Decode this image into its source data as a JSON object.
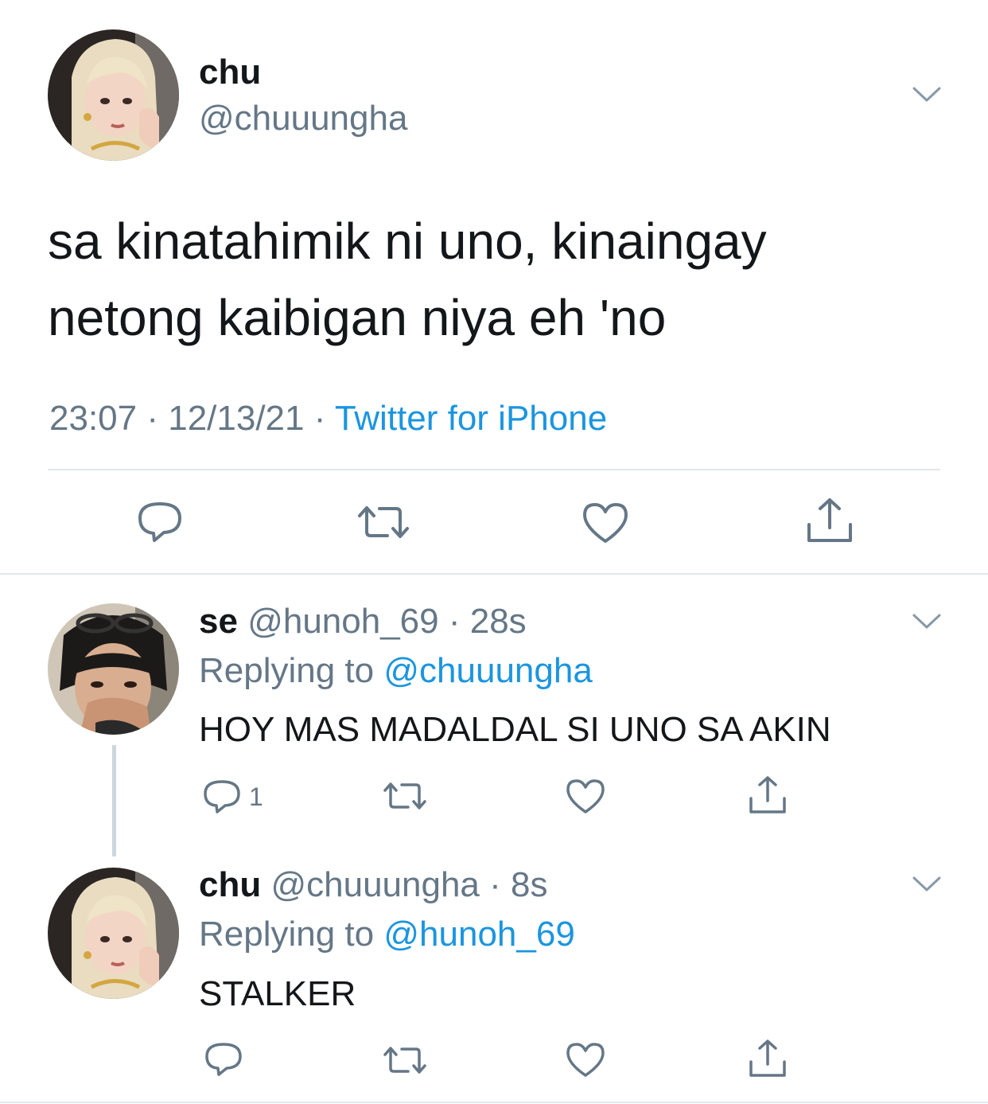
{
  "colors": {
    "text": "#14171a",
    "secondary": "#657786",
    "link": "#1b95e0",
    "divider": "#e1e8ed",
    "thread_line": "#ccd6dd"
  },
  "main_tweet": {
    "name": "chu",
    "handle": "@chuuungha",
    "text_line1": "sa kinatahimik ni uno, kinaingay",
    "text_line2": "netong kaibigan niya eh 'no",
    "time": "23:07",
    "sep1": " · ",
    "date": "12/13/21",
    "sep2": " · ",
    "source": "Twitter for iPhone",
    "menu_icon": "chevron-down-icon",
    "actions": [
      "reply-icon",
      "retweet-icon",
      "like-icon",
      "share-icon"
    ]
  },
  "replies": [
    {
      "name": "se",
      "handle": "@hunoh_69",
      "sep": " · ",
      "age": "28s",
      "replying_prefix": "Replying to ",
      "replying_to": "@chuuungha",
      "text": "HOY MAS MADALDAL SI UNO SA AKIN",
      "reply_count": "1",
      "menu_icon": "chevron-down-icon"
    },
    {
      "name": "chu",
      "handle": "@chuuungha",
      "sep": " · ",
      "age": "8s",
      "replying_prefix": "Replying to ",
      "replying_to": "@hunoh_69",
      "text": "STALKER",
      "reply_count": "",
      "menu_icon": "chevron-down-icon"
    }
  ]
}
